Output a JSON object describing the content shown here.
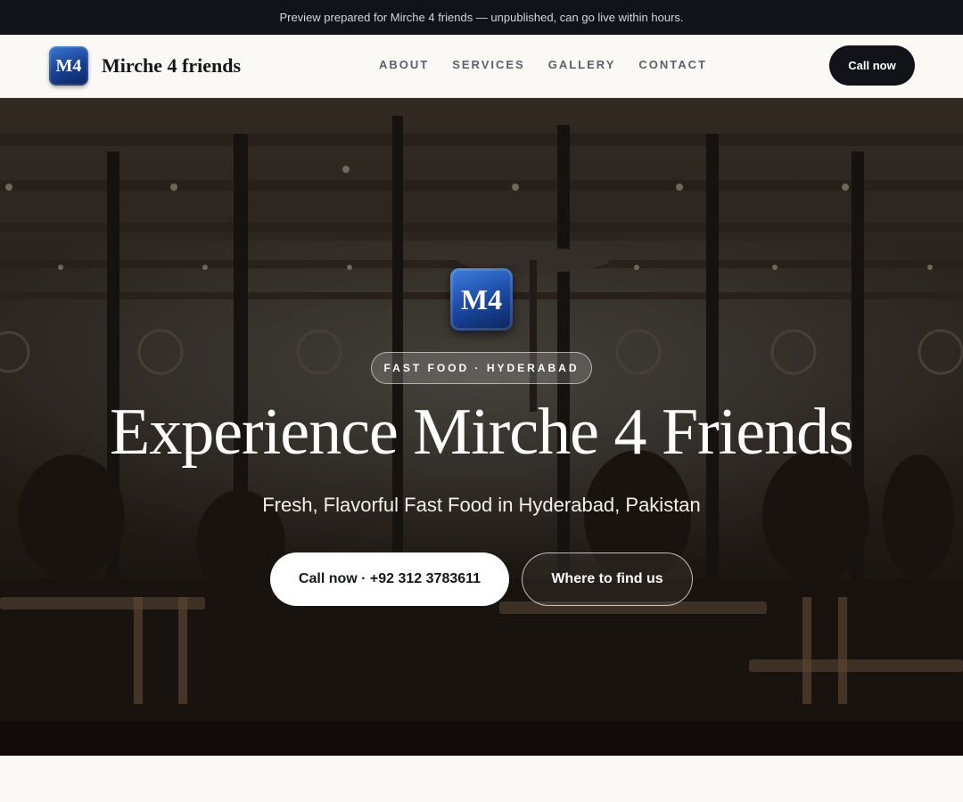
{
  "banner": {
    "text": "Preview prepared for Mirche 4 friends — unpublished, can go live within hours."
  },
  "header": {
    "logo_text": "M4",
    "brand_name": "Mirche 4 friends",
    "nav": [
      {
        "label": "ABOUT"
      },
      {
        "label": "SERVICES"
      },
      {
        "label": "GALLERY"
      },
      {
        "label": "CONTACT"
      }
    ],
    "cta_label": "Call now"
  },
  "hero": {
    "background": "restaurant interior photo",
    "logo_text": "M4",
    "tagline": "FAST FOOD · HYDERABAD",
    "title": "Experience Mirche 4 Friends",
    "subtitle": "Fresh, Flavorful Fast Food in Hyderabad, Pakistan",
    "primary_button": "Call now · +92 312 3783611",
    "secondary_button": "Where to find us"
  },
  "colors": {
    "banner_bg": "#111318",
    "page_bg": "#faf9f6",
    "logo_blue": "#1a46a0",
    "cta_bg": "#111318",
    "hero_overlay": "#0a0806"
  }
}
